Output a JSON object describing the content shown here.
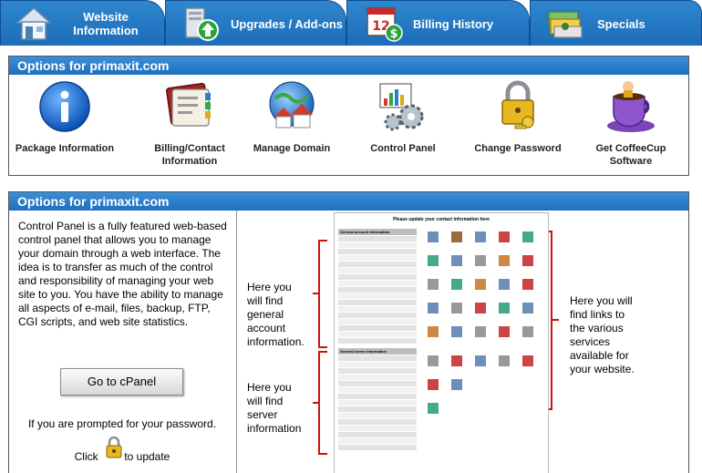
{
  "tabs": [
    {
      "name": "tab-website-information",
      "label": "Website Information",
      "line1": "Website",
      "line2": "Information",
      "icon": "house-icon"
    },
    {
      "name": "tab-upgrades-addons",
      "label": "Upgrades / Add-ons",
      "icon": "server-upgrade-icon"
    },
    {
      "name": "tab-billing-history",
      "label": "Billing History",
      "icon": "calendar-dollar-icon"
    },
    {
      "name": "tab-specials",
      "label": "Specials",
      "icon": "cash-stack-icon"
    }
  ],
  "options_panel": {
    "title": "Options for primaxit.com",
    "items": [
      {
        "label1": "Package Information",
        "label2": "",
        "icon": "info-icon"
      },
      {
        "label1": "Billing/Contact",
        "label2": "Information",
        "icon": "address-book-icon"
      },
      {
        "label1": "Manage Domain",
        "label2": "",
        "icon": "globe-houses-icon"
      },
      {
        "label1": "Control Panel",
        "label2": "",
        "icon": "control-panel-gears-icon"
      },
      {
        "label1": "Change Password",
        "label2": "",
        "icon": "padlock-key-icon"
      },
      {
        "label1": "Get CoffeeCup",
        "label2": "Software",
        "icon": "coffee-cup-icon"
      }
    ]
  },
  "control_panel": {
    "title": "Options for primaxit.com",
    "description": "Control Panel is a fully featured web-based control panel that allows you to manage your domain through a web interface. The idea is to transfer as much of the control and responsibility of managing your web site to you. You have the ability to manage all aspects of e-mail, files, backup, FTP, CGI scripts, and web site statistics.",
    "button": "Go to cPanel",
    "prompt": "If you are prompted for your password.",
    "click_before": "Click",
    "click_after": "to update",
    "callout_account": [
      "Here you",
      "will find",
      "general",
      "account",
      "information."
    ],
    "callout_server": [
      "Here you",
      "will find",
      "server",
      "information"
    ],
    "callout_links": [
      "Here you will",
      "find links to",
      "the various",
      "services",
      "available for",
      "your website."
    ],
    "screenshot_heading": "Please update your contact information here",
    "screenshot_general": "General account information",
    "screenshot_server": "General server information"
  },
  "colors": {
    "tab_blue": "#1c6db8",
    "header_blue": "#2a80cc",
    "bracket_red": "#cc1111"
  }
}
